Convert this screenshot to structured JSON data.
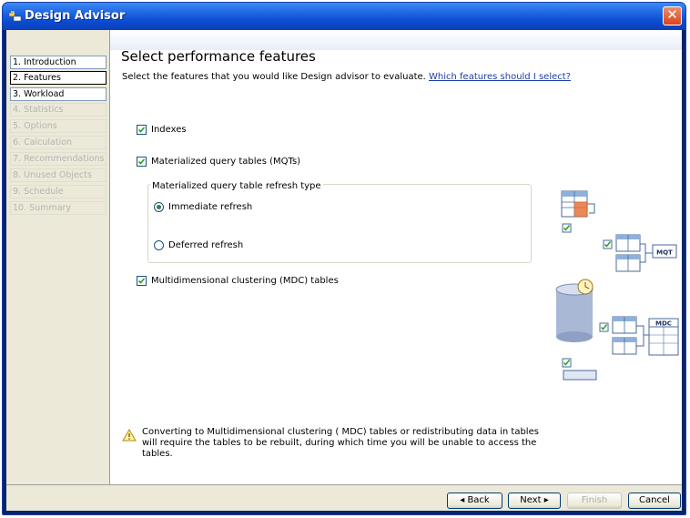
{
  "window": {
    "title": "Design Advisor",
    "close_label": "✕"
  },
  "nav": {
    "items": [
      {
        "label": "1. Introduction",
        "state": "enabled"
      },
      {
        "label": "2. Features",
        "state": "current"
      },
      {
        "label": "3. Workload",
        "state": "enabled"
      },
      {
        "label": "4. Statistics",
        "state": "disabled"
      },
      {
        "label": "5. Options",
        "state": "disabled"
      },
      {
        "label": "6. Calculation",
        "state": "disabled"
      },
      {
        "label": "7. Recommendations",
        "state": "disabled"
      },
      {
        "label": "8. Unused Objects",
        "state": "disabled"
      },
      {
        "label": "9. Schedule",
        "state": "disabled"
      },
      {
        "label": "10. Summary",
        "state": "disabled"
      }
    ]
  },
  "page": {
    "title": "Select performance features",
    "subtitle": "Select the features that you would like Design advisor to evaluate.",
    "help_link": "Which features should I select?"
  },
  "features": {
    "indexes": {
      "label": "Indexes",
      "checked": true
    },
    "mqt": {
      "label": "Materialized query tables (MQTs)",
      "checked": true
    },
    "mdc": {
      "label": "Multidimensional clustering (MDC) tables",
      "checked": true
    }
  },
  "refresh_group": {
    "legend": "Materialized query table refresh type",
    "immediate": {
      "label": "Immediate refresh",
      "selected": true
    },
    "deferred": {
      "label": "Deferred refresh",
      "selected": false
    }
  },
  "illustration": {
    "mqt_label": "MQT",
    "mdc_label": "MDC"
  },
  "warning": {
    "text": "Converting to Multidimensional clustering ( MDC) tables or redistributing data in tables will require the tables to be rebuilt, during which time you will be unable to access the tables."
  },
  "buttons": {
    "back": "◂ Back",
    "next": "Next ▸",
    "finish": "Finish",
    "cancel": "Cancel"
  }
}
